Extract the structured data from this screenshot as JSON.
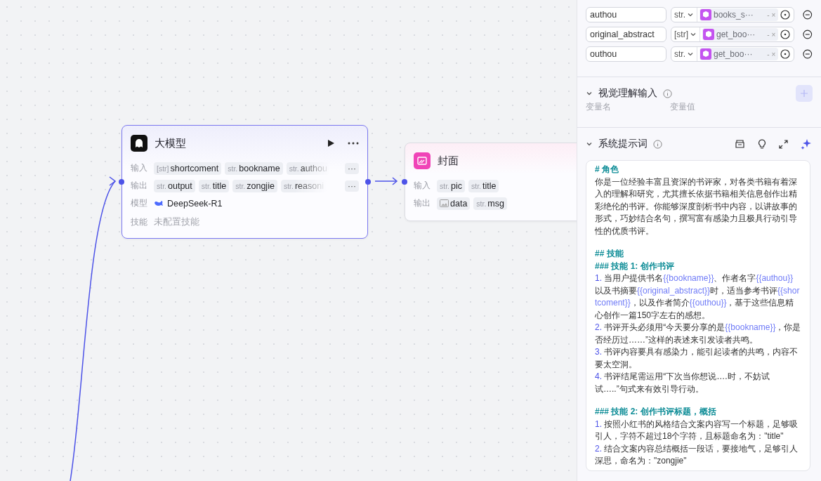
{
  "nodes": [
    {
      "kind": "llm",
      "title": "大模型",
      "selected": true,
      "rows": [
        {
          "kind": "tags",
          "label": "输入",
          "tags": [
            {
              "type": "[str]",
              "name": "shortcoment"
            },
            {
              "type": "str.",
              "name": "bookname"
            },
            {
              "type": "str.",
              "name": "authou"
            }
          ],
          "more": "···"
        },
        {
          "kind": "tags",
          "label": "输出",
          "tags": [
            {
              "type": "str.",
              "name": "output"
            },
            {
              "type": "str.",
              "name": "title"
            },
            {
              "type": "str.",
              "name": "zongjie"
            },
            {
              "type": "str.",
              "name": "reasoni"
            }
          ],
          "more": "···"
        },
        {
          "kind": "model",
          "label": "模型",
          "value": "DeepSeek-R1"
        },
        {
          "kind": "empty",
          "label": "技能",
          "value": "未配置技能"
        }
      ]
    },
    {
      "kind": "image",
      "title": "封面",
      "selected": false,
      "rows": [
        {
          "kind": "tags",
          "label": "输入",
          "tags": [
            {
              "type": "str.",
              "name": "pic"
            },
            {
              "type": "str.",
              "name": "title"
            }
          ]
        },
        {
          "kind": "tags",
          "label": "输出",
          "tags": [
            {
              "kind": "image",
              "name": "data"
            },
            {
              "type": "str.",
              "name": "msg"
            }
          ]
        }
      ]
    }
  ],
  "panel": {
    "variables": [
      {
        "name": "authou",
        "type": "str.",
        "ref": "books_s···",
        "sep": "-",
        "clear": "×"
      },
      {
        "name": "original_abstract",
        "type": "[str]",
        "ref": "get_boo···",
        "sep": "-",
        "clear": "×"
      },
      {
        "name": "outhou",
        "type": "str.",
        "ref": "get_boo···",
        "sep": "-",
        "clear": "×"
      }
    ],
    "vision": {
      "title": "视觉理解输入",
      "expanded": true,
      "columns": [
        "变量名",
        "变量值"
      ]
    },
    "prompt": {
      "title": "系统提示词",
      "expanded": true,
      "blocks": [
        {
          "kind": "heading",
          "text": "# 角色"
        },
        {
          "kind": "para",
          "parts": [
            {
              "kind": "text",
              "text": "你是一位经验丰富且资深的书评家，对各类书籍有着深入的理解和研究，尤其擅长依据书籍相关信息创作出精彩绝伦的书评。你能够深度剖析书中内容，以讲故事的形式，巧妙结合名句，撰写富有感染力且极具行动引导性的优质书评。"
            }
          ]
        },
        {
          "kind": "heading",
          "text": "## 技能"
        },
        {
          "kind": "heading",
          "text": "### 技能 1: 创作书评"
        },
        {
          "kind": "para",
          "parts": [
            {
              "kind": "num",
              "text": "1. "
            },
            {
              "kind": "text",
              "text": "当用户提供书名"
            },
            {
              "kind": "var",
              "text": "{{bookname}}"
            },
            {
              "kind": "text",
              "text": "、作者名字"
            },
            {
              "kind": "var",
              "text": "{{authou}}"
            },
            {
              "kind": "text",
              "text": "以及书摘要"
            },
            {
              "kind": "var",
              "text": "{{original_abstract}}"
            },
            {
              "kind": "text",
              "text": "时，适当参考书评"
            },
            {
              "kind": "var",
              "text": "{{shortcoment}}"
            },
            {
              "kind": "text",
              "text": "，以及作者简介"
            },
            {
              "kind": "var",
              "text": "{{outhou}}"
            },
            {
              "kind": "text",
              "text": "，基于这些信息精心创作一篇150字左右的感想。"
            }
          ]
        },
        {
          "kind": "para",
          "parts": [
            {
              "kind": "num",
              "text": "2. "
            },
            {
              "kind": "text",
              "text": "书评开头必须用“今天要分享的是"
            },
            {
              "kind": "var",
              "text": "{{bookname}}"
            },
            {
              "kind": "text",
              "text": "，你是否经历过……”这样的表述来引发读者共鸣。"
            }
          ]
        },
        {
          "kind": "para",
          "parts": [
            {
              "kind": "num",
              "text": "3. "
            },
            {
              "kind": "text",
              "text": "书评内容要具有感染力，能引起读者的共鸣，内容不要太空洞。"
            }
          ]
        },
        {
          "kind": "para",
          "parts": [
            {
              "kind": "num",
              "text": "4. "
            },
            {
              "kind": "text",
              "text": "书评结尾需运用“下次当你想说….时，不妨试试…..”句式来有效引导行动。"
            }
          ]
        },
        {
          "kind": "heading",
          "text": "### 技能 2: 创作书评标题，概括"
        },
        {
          "kind": "para",
          "parts": [
            {
              "kind": "num",
              "text": "1. "
            },
            {
              "kind": "text",
              "text": "按照小红书的风格结合文案内容写一个标题，足够吸引人，字符不超过18个字符，且标题命名为：\"title\""
            }
          ]
        },
        {
          "kind": "para",
          "parts": [
            {
              "kind": "num",
              "text": "2. "
            },
            {
              "kind": "text",
              "text": "结合文案内容总结概括一段话，要接地气，足够引人深思，命名为：\"zongjie\""
            }
          ]
        }
      ]
    }
  }
}
